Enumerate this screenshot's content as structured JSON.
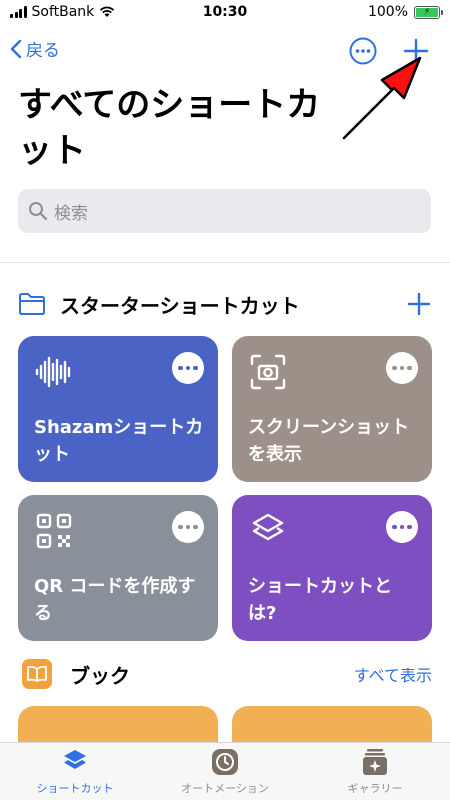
{
  "status_bar": {
    "carrier": "SoftBank",
    "time": "10:30",
    "battery": "100%"
  },
  "nav": {
    "back_label": "戻る"
  },
  "title": "すべてのショートカット",
  "search": {
    "placeholder": "検索"
  },
  "starter_section": {
    "label": "スターターショートカット"
  },
  "cards": [
    {
      "label": "Shazamショートカット",
      "color": "#4b63c4"
    },
    {
      "label": "スクリーンショットを表示",
      "color": "#9d9088"
    },
    {
      "label": "QR コードを作成する",
      "color": "#8a9099"
    },
    {
      "label": "ショートカットとは?",
      "color": "#7d4fc0"
    }
  ],
  "book_section": {
    "label": "ブック",
    "see_all": "すべて表示"
  },
  "tabs": [
    {
      "label": "ショートカット",
      "selected": true
    },
    {
      "label": "オートメーション",
      "selected": false
    },
    {
      "label": "ギャラリー",
      "selected": false
    }
  ],
  "colors": {
    "accent": "#2f6fe0",
    "arrow": "#ff0000",
    "book": "#f1a23e"
  }
}
